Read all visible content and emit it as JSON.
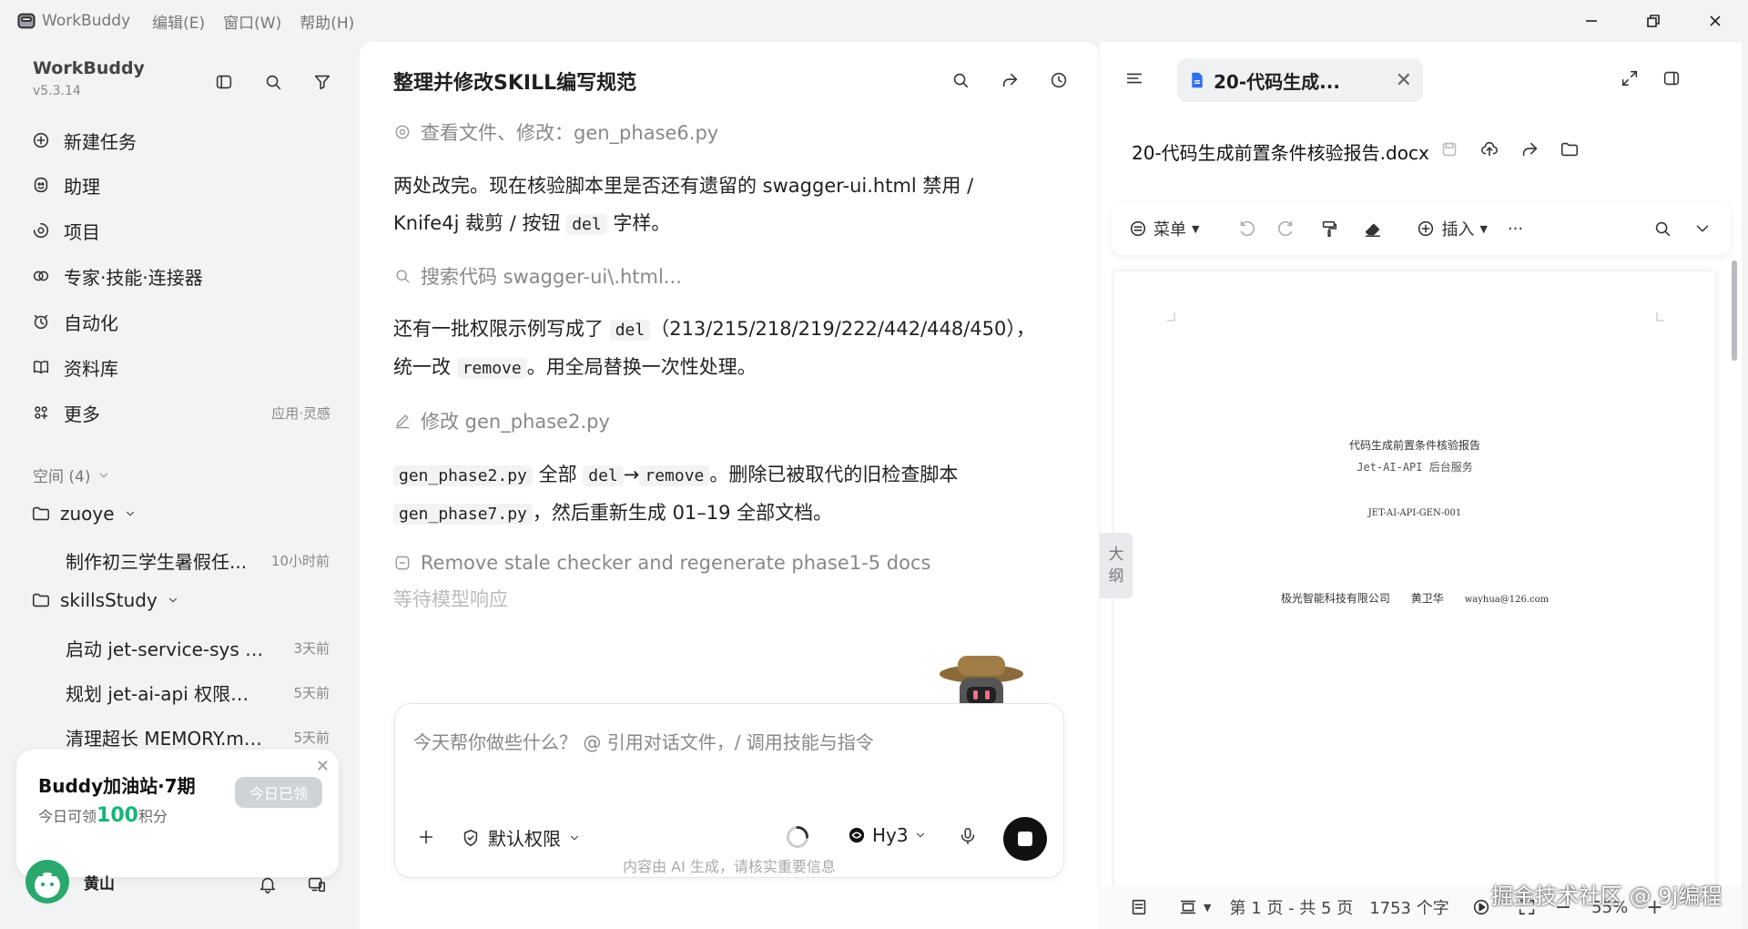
{
  "titlebar": {
    "app_name": "WorkBuddy",
    "menus": [
      "编辑(E)",
      "窗口(W)",
      "帮助(H)"
    ]
  },
  "sidebar": {
    "brand": "WorkBuddy",
    "version": "v5.3.14",
    "nav": [
      {
        "label": "新建任务",
        "icon": "plus-circle-icon"
      },
      {
        "label": "助理",
        "icon": "assistant-icon"
      },
      {
        "label": "项目",
        "icon": "project-icon"
      },
      {
        "label": "专家·技能·连接器",
        "icon": "expert-icon"
      },
      {
        "label": "自动化",
        "icon": "automation-icon"
      },
      {
        "label": "资料库",
        "icon": "book-icon"
      },
      {
        "label": "更多",
        "icon": "grid-icon",
        "hint": "应用·灵感"
      }
    ],
    "space_header": "空间 (4)",
    "folders": [
      {
        "name": "zuoye",
        "tasks": [
          {
            "title": "制作初三学生暑假任...",
            "time": "10小时前"
          }
        ]
      },
      {
        "name": "skillsStudy",
        "tasks": [
          {
            "title": "启动 jet-service-sys 后...",
            "time": "3天前"
          },
          {
            "title": "规划 jet-ai-api 权限框...",
            "time": "5天前"
          },
          {
            "title": "清理超长 MEMORY.md ...",
            "time": "5天前"
          }
        ]
      }
    ],
    "promo": {
      "title": "Buddy加油站·7期",
      "text_pre": "今日可领",
      "points": "100",
      "text_post": "积分",
      "button": "今日已领"
    },
    "user": {
      "name": "黄山"
    }
  },
  "chat": {
    "title": "整理并修改SKILL编写规范",
    "steps": [
      "查看文件、修改：gen_phase6.py",
      "搜索代码 swagger-ui\\.html...",
      "修改 gen_phase2.py",
      "Remove stale checker and regenerate phase1-5 docs"
    ],
    "para1": {
      "a": "两处改完。现在核验脚本里是否还有遗留的 swagger-ui.html 禁用 /",
      "b": "Knife4j 裁剪 / 按钮 ",
      "code": "del",
      "c": " 字样。"
    },
    "para2": {
      "a": "还有一批权限示例写成了 ",
      "code1": "del",
      "b": "（213/215/218/219/222/442/448/450），",
      "c": "统一改 ",
      "code2": "remove",
      "d": "。用全局替换一次性处理。"
    },
    "para3": {
      "code1": "gen_phase2.py",
      "a": " 全部 ",
      "code2": "del",
      "arrow": "→",
      "code3": "remove",
      "b": "。删除已被取代的旧检查脚本",
      "code4": "gen_phase7.py",
      "c": "，然后重新生成 01–19 全部文档。"
    },
    "waiting": "等待模型响应",
    "input_placeholder": "今天帮你做些什么？ @ 引用对话文件，/ 调用技能与指令",
    "permission": "默认权限",
    "model": "Hy3",
    "disclaimer": "内容由 AI 生成，请核实重要信息"
  },
  "doc": {
    "tab_title": "20-代码生成...",
    "file_name": "20-代码生成前置条件核验报告.docx",
    "toolbar": {
      "menu": "菜单",
      "insert": "插入",
      "more": "···"
    },
    "outline": [
      "大",
      "纲"
    ],
    "page": {
      "title": "代码生成前置条件核验报告",
      "subtitle": "Jet-AI-API 后台服务",
      "code": "JET-AI-API-GEN-001",
      "company": "极光智能科技有限公司",
      "author": "黄卫华",
      "email": "wayhua@126.com"
    },
    "status": {
      "page": "第 1 页 - 共 5 页",
      "words": "1753 个字",
      "zoom": "55%"
    }
  },
  "watermark": "掘金技术社区 @ 9j编程"
}
